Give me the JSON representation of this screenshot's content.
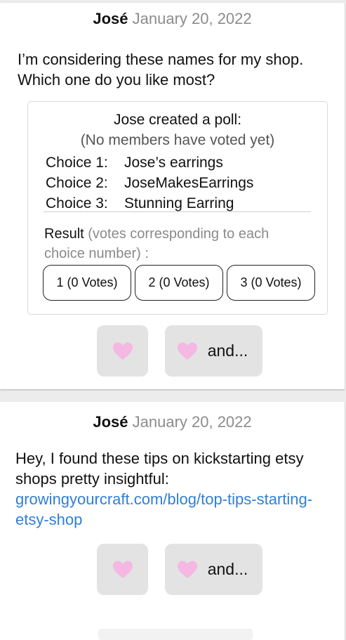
{
  "colors": {
    "background": "#ececec",
    "card": "#ffffff",
    "link": "#2f7fd6",
    "heart": "#f4b8e2",
    "reaction_bg": "#e3e3e3"
  },
  "posts": [
    {
      "author": "José",
      "date": "January 20, 2022",
      "text": "I’m considering these names for my shop. Which one do you like most?",
      "poll": {
        "title": "Jose created a poll:",
        "subtitle": "(No members have voted yet)",
        "choices": [
          {
            "label": "Choice 1:",
            "name": "Jose’s earrings"
          },
          {
            "label": "Choice 2:",
            "name": "JoseMakesEarrings"
          },
          {
            "label": "Choice 3:",
            "name": "Stunning Earring"
          }
        ],
        "result_label": "Result",
        "result_hint": "(votes corresponding to each choice number) :",
        "vote_buttons": [
          "1 (0 Votes)",
          "2 (0 Votes)",
          "3 (0 Votes)"
        ]
      },
      "reactions": {
        "like_icon": "heart-icon",
        "more_label": "and..."
      }
    },
    {
      "author": "José",
      "date": "January 20, 2022",
      "text": "Hey, I found these tips on kickstarting etsy shops pretty insightful:",
      "link": "growingyourcraft.com/blog/top-tips-starting-etsy-shop",
      "reactions": {
        "like_icon": "heart-icon",
        "more_label": "and..."
      }
    }
  ]
}
